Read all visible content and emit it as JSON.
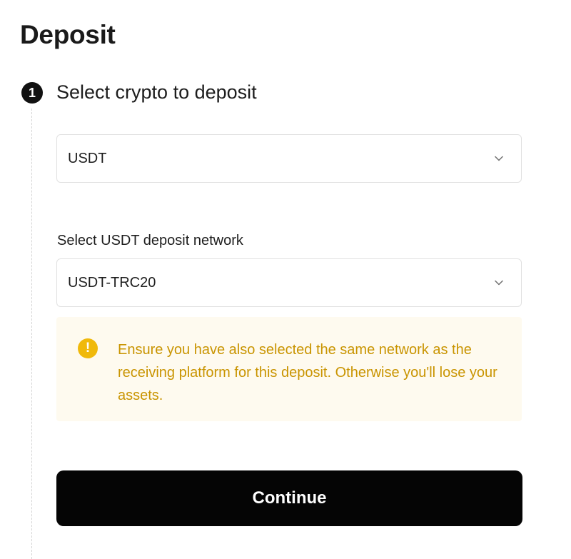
{
  "page": {
    "title": "Deposit"
  },
  "step": {
    "number": "1",
    "title": "Select crypto to deposit"
  },
  "crypto_select": {
    "value": "USDT",
    "icon": "chevron-down-icon"
  },
  "network": {
    "label": "Select USDT deposit network",
    "value": "USDT-TRC20",
    "icon": "chevron-down-icon"
  },
  "warning": {
    "icon_glyph": "!",
    "icon": "warning-icon",
    "text": "Ensure you have also selected the same network as the receiving platform for this deposit. Otherwise you'll lose your assets.",
    "color": "#c99400",
    "background": "#fefaef"
  },
  "actions": {
    "continue_label": "Continue"
  },
  "colors": {
    "accent": "#f0b90b",
    "button": "#050505",
    "text": "#1e1e1e"
  }
}
